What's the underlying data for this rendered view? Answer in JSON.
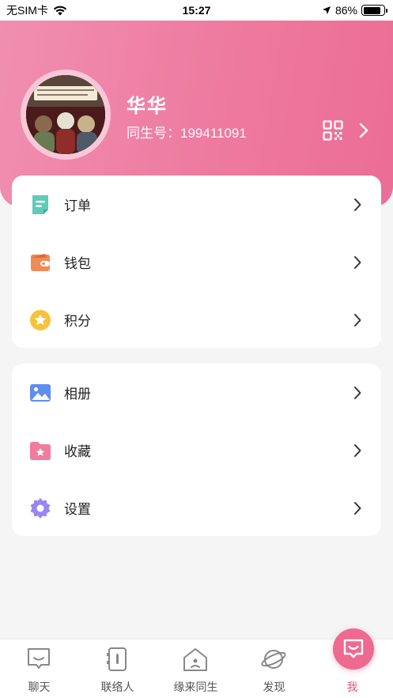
{
  "status_bar": {
    "carrier": "无SIM卡",
    "time": "15:27",
    "battery": "86%",
    "battery_level": 0.86
  },
  "profile": {
    "name": "华华",
    "id_label": "同生号：199411091"
  },
  "menu_group_1": [
    {
      "label": "订单",
      "icon": "order-icon",
      "color": "#5fcbb8"
    },
    {
      "label": "钱包",
      "icon": "wallet-icon",
      "color": "#f08a56"
    },
    {
      "label": "积分",
      "icon": "points-star-icon",
      "color": "#f6c23c"
    }
  ],
  "menu_group_2": [
    {
      "label": "相册",
      "icon": "album-icon",
      "color": "#5f8ef0"
    },
    {
      "label": "收藏",
      "icon": "favorites-icon",
      "color": "#f07ca0"
    },
    {
      "label": "设置",
      "icon": "settings-gear-icon",
      "color": "#9a86f0"
    }
  ],
  "tabs": [
    {
      "label": "聊天",
      "icon": "chat-icon"
    },
    {
      "label": "联络人",
      "icon": "contacts-icon"
    },
    {
      "label": "缘来同生",
      "icon": "home-icon"
    },
    {
      "label": "发现",
      "icon": "discover-planet-icon"
    },
    {
      "label": "我",
      "icon": "me-smile-icon",
      "active": true
    }
  ],
  "colors": {
    "accent": "#ee6a90",
    "header_start": "#f08fb0",
    "header_end": "#ec6d95"
  }
}
